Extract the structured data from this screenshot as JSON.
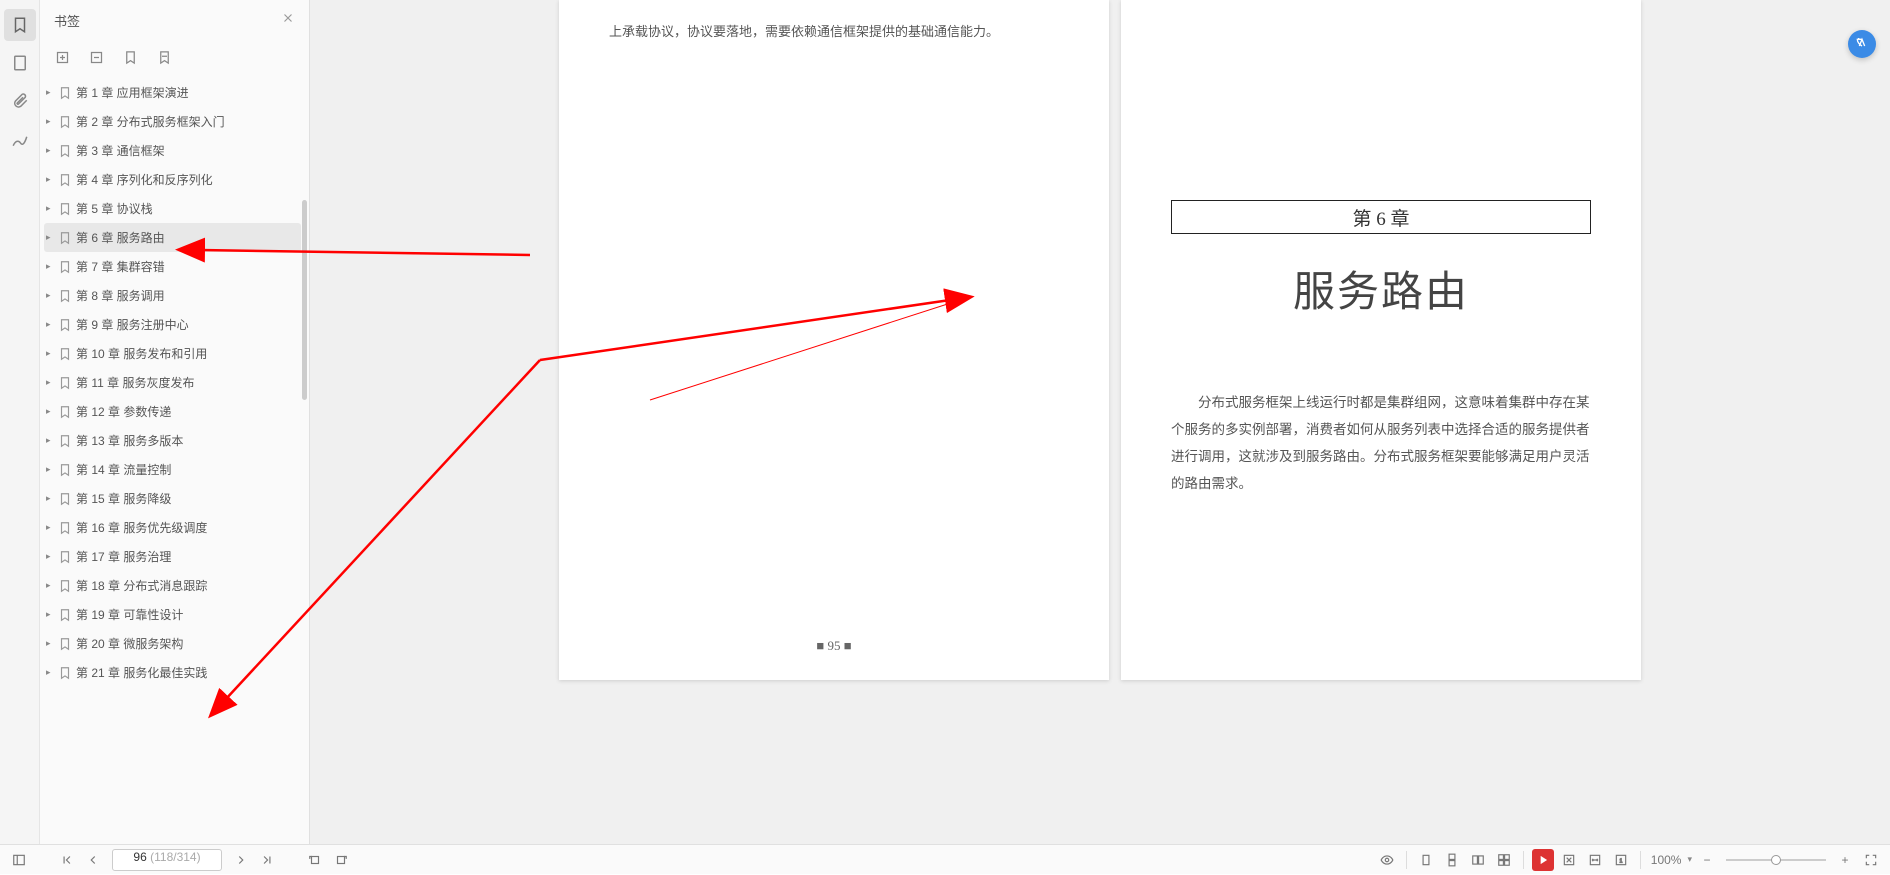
{
  "sidebar": {
    "title": "书签",
    "selectedIndex": 5,
    "items": [
      {
        "label": "第 1 章 应用框架演进"
      },
      {
        "label": "第 2 章 分布式服务框架入门"
      },
      {
        "label": "第 3 章 通信框架"
      },
      {
        "label": "第 4 章 序列化和反序列化"
      },
      {
        "label": "第 5 章 协议栈"
      },
      {
        "label": "第 6 章 服务路由"
      },
      {
        "label": "第 7 章 集群容错"
      },
      {
        "label": "第 8 章 服务调用"
      },
      {
        "label": "第 9 章 服务注册中心"
      },
      {
        "label": "第 10 章 服务发布和引用"
      },
      {
        "label": "第 11 章 服务灰度发布"
      },
      {
        "label": "第 12 章 参数传递"
      },
      {
        "label": "第 13 章 服务多版本"
      },
      {
        "label": "第 14 章 流量控制"
      },
      {
        "label": "第 15 章 服务降级"
      },
      {
        "label": "第 16 章 服务优先级调度"
      },
      {
        "label": "第 17 章 服务治理"
      },
      {
        "label": "第 18 章 分布式消息跟踪"
      },
      {
        "label": "第 19 章 可靠性设计"
      },
      {
        "label": "第 20 章 微服务架构"
      },
      {
        "label": "第 21 章 服务化最佳实践"
      }
    ]
  },
  "doc": {
    "leftPageTopText": "上承载协议，协议要落地，需要依赖通信框架提供的基础通信能力。",
    "chapterBox": "第 6 章",
    "chapterTitle": "服务路由",
    "chapterIntro": "分布式服务框架上线运行时都是集群组网，这意味着集群中存在某个服务的多实例部署，消费者如何从服务列表中选择合适的服务提供者进行调用，这就涉及到服务路由。分布式服务框架要能够满足用户灵活的路由需求。",
    "leftPageNum": "■ 95 ■"
  },
  "bottomBar": {
    "pageCurrent": "96",
    "pageTotal": "(118/314)",
    "zoomLabel": "100%"
  },
  "colors": {
    "annotation": "#ff0000",
    "accent": "#3b8be6"
  }
}
